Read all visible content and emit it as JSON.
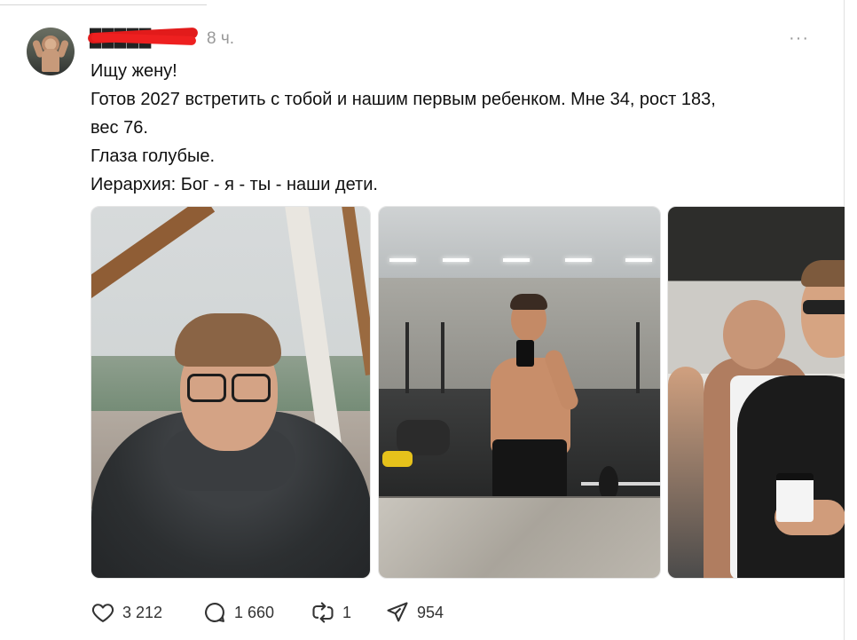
{
  "post": {
    "username": "█████",
    "time": "8 ч.",
    "more": "···",
    "lines": [
      "Ищу жену!",
      "Готов 2027 встретить с тобой и нашим первым ребенком. Мне 34, рост 183,",
      "вес 76.",
      "Глаза голубые.",
      "Иерархия: Бог - я - ты - наши дети."
    ]
  },
  "actions": {
    "likes": "3 212",
    "replies": "1 660",
    "reposts": "1",
    "shares": "954"
  },
  "icons": {
    "like": "heart-icon",
    "reply": "comment-icon",
    "repost": "repost-icon",
    "share": "send-icon"
  },
  "colors": {
    "text": "#101010",
    "muted": "#999999",
    "redaction": "#e21b1b"
  }
}
